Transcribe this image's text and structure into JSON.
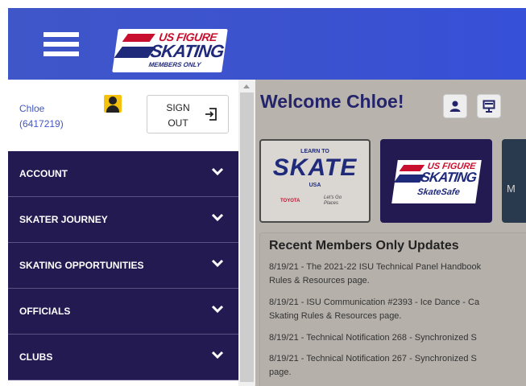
{
  "header": {
    "logo_line1": "US FIGURE",
    "logo_line2": "SKATING",
    "logo_line3": "MEMBERS ONLY"
  },
  "user": {
    "name": "Chloe",
    "member_id": "(6417219)",
    "signout_line1": "SIGN",
    "signout_line2": "OUT"
  },
  "menu": {
    "items": [
      {
        "label": "ACCOUNT"
      },
      {
        "label": "SKATER JOURNEY"
      },
      {
        "label": "SKATING OPPORTUNITIES"
      },
      {
        "label": "OFFICIALS"
      },
      {
        "label": "CLUBS"
      }
    ]
  },
  "main": {
    "welcome": "Welcome Chloe!",
    "cards": {
      "learn_line1": "LEARN TO",
      "learn_line2": "SKATE",
      "learn_line3": "USA",
      "learn_sponsor": "TOYOTA",
      "learn_tagline": "Let's Go Places",
      "safe_line1": "US FIGURE",
      "safe_line2": "SKATING",
      "safe_line3": "SkateSafe",
      "third_letter": "M"
    },
    "updates": {
      "title": "Recent Members Only Updates",
      "items": [
        {
          "line1": "8/19/21 - The 2021-22 ISU Technical Panel Handbook",
          "line2": "Rules & Resources page."
        },
        {
          "line1": "8/19/21 - ISU Communication #2393 - Ice Dance - Ca",
          "line2": "Skating Rules & Resources page."
        },
        {
          "line1": "8/19/21 - Technical Notification 268 - Synchronized S"
        },
        {
          "line1": "8/19/21 - Technical Notification 267 - Synchronized S",
          "line2": "page."
        }
      ]
    }
  },
  "colors": {
    "header_blue": "#3f56c9",
    "menu_navy": "#231a52",
    "welcome_navy": "#24246a",
    "overlay_gray": "#b8b3ad"
  }
}
